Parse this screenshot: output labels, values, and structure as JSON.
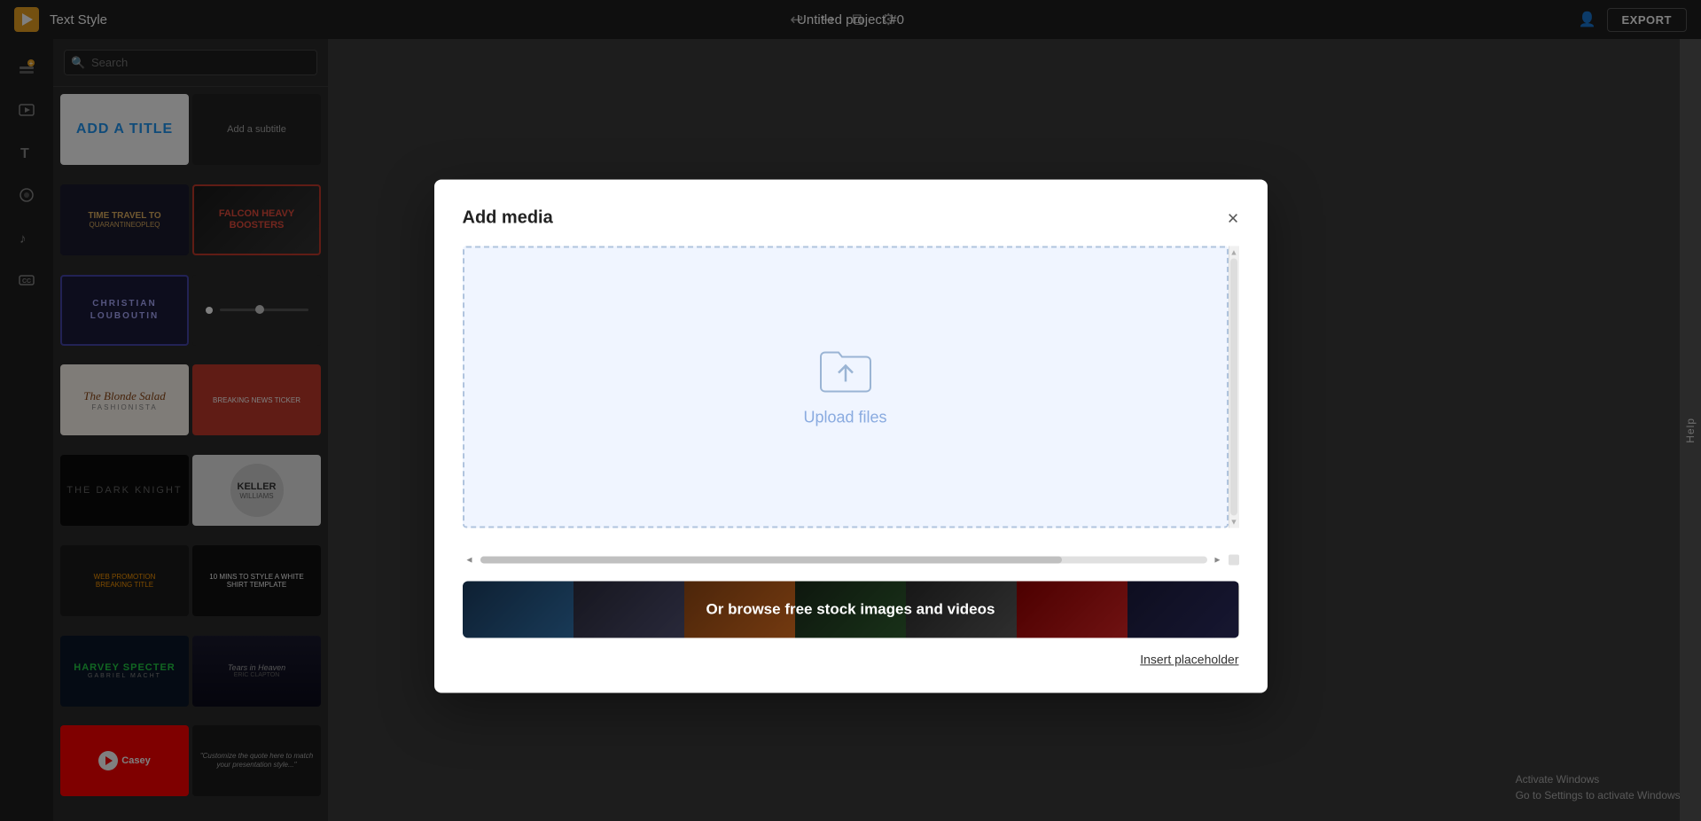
{
  "app": {
    "logo_letter": "▶",
    "title": "Text Style",
    "project_title": "Untitled project #0",
    "export_label": "EXPORT"
  },
  "toolbar": {
    "undo_icon": "↩",
    "redo_icon": "↪",
    "duplicate_icon": "⧉",
    "settings_icon": "⚙"
  },
  "sidebar": {
    "icons": [
      {
        "name": "add-layer-icon",
        "symbol": "⊕",
        "label": "Add layer"
      },
      {
        "name": "media-icon",
        "symbol": "▶",
        "label": "Media"
      },
      {
        "name": "text-icon",
        "symbol": "T",
        "label": "Text"
      },
      {
        "name": "shapes-icon",
        "symbol": "◎",
        "label": "Shapes"
      },
      {
        "name": "music-icon",
        "symbol": "♪",
        "label": "Music"
      },
      {
        "name": "captions-icon",
        "symbol": "CC",
        "label": "Captions"
      }
    ]
  },
  "search": {
    "placeholder": "Search",
    "value": ""
  },
  "templates": [
    {
      "id": "add-title",
      "type": "add-title"
    },
    {
      "id": "subtitle",
      "type": "subtitle"
    },
    {
      "id": "time-travel",
      "type": "time-travel"
    },
    {
      "id": "falcon",
      "type": "falcon"
    },
    {
      "id": "christian",
      "type": "christian"
    },
    {
      "id": "slider",
      "type": "slider"
    },
    {
      "id": "blonde-salad",
      "type": "blonde-salad"
    },
    {
      "id": "red-bar",
      "type": "red-bar"
    },
    {
      "id": "dark-knight",
      "type": "dark-knight"
    },
    {
      "id": "keller-williams",
      "type": "keller-williams"
    },
    {
      "id": "web",
      "type": "web"
    },
    {
      "id": "10mins",
      "type": "10mins"
    },
    {
      "id": "harvey",
      "type": "harvey"
    },
    {
      "id": "tears",
      "type": "tears"
    },
    {
      "id": "casey",
      "type": "casey"
    },
    {
      "id": "quote",
      "type": "quote"
    }
  ],
  "modal": {
    "title": "Add media",
    "close_label": "×",
    "upload_label": "Upload files",
    "browse_label": "Or browse free stock images and videos",
    "insert_placeholder_label": "Insert placeholder"
  },
  "help": {
    "label": "Help"
  },
  "windows_activation": {
    "line1": "Activate Windows",
    "line2": "Go to Settings to activate Windows."
  }
}
